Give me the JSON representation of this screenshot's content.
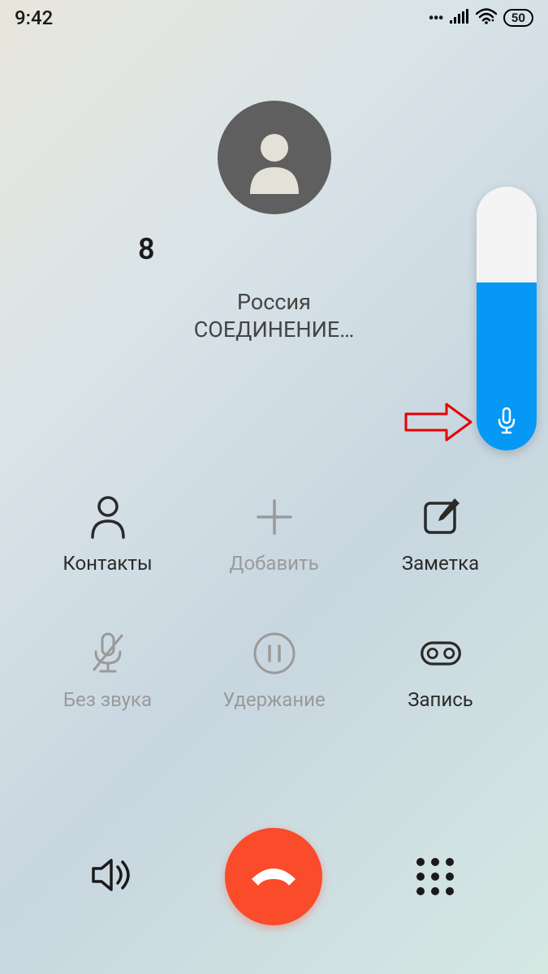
{
  "status": {
    "time": "9:42",
    "battery": "50"
  },
  "call": {
    "phone_number": "8",
    "country": "Россия",
    "status": "СОЕДИНЕНИЕ…"
  },
  "volume": {
    "level_percent": 62
  },
  "actions": {
    "contacts": "Контакты",
    "add": "Добавить",
    "note": "Заметка",
    "mute": "Без звука",
    "hold": "Удержание",
    "record": "Запись"
  },
  "icons": {
    "avatar": "person-silhouette-icon",
    "contacts": "person-icon",
    "add": "plus-icon",
    "note": "compose-icon",
    "mute": "mic-muted-icon",
    "hold": "pause-circle-icon",
    "record": "voicemail-icon",
    "speaker": "speaker-icon",
    "end_call": "phone-down-icon",
    "keypad": "keypad-icon",
    "mic": "microphone-icon"
  },
  "colors": {
    "end_call_bg": "#fa4b2a",
    "volume_fill": "#0698f5",
    "text_primary": "#1a1a1a",
    "text_disabled": "#9a9a9a"
  }
}
